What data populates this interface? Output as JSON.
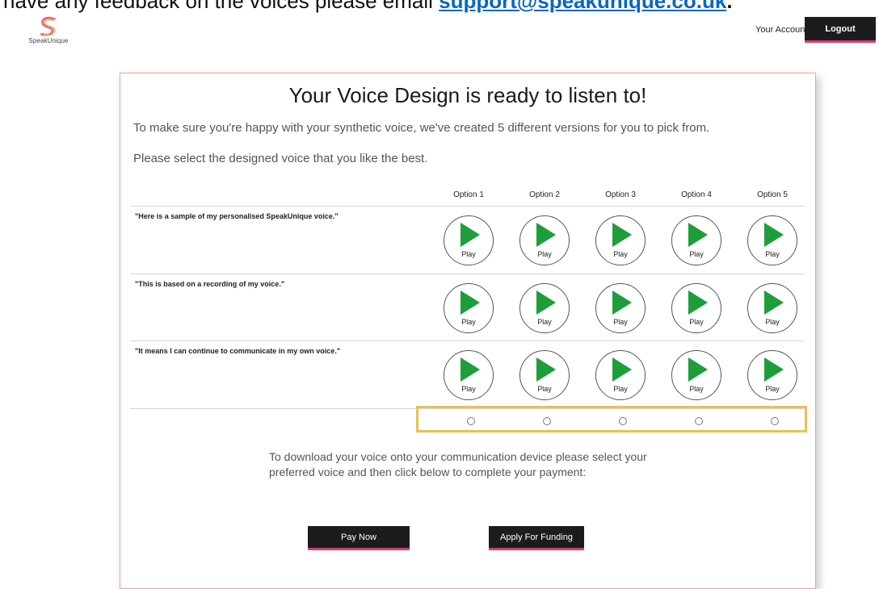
{
  "banner": {
    "lead_text": "have any feedback on the voices please email ",
    "email": "support@speakunique.co.uk",
    "trail": "."
  },
  "logo": {
    "text": "SpeakUnique",
    "icon": "speakunique-s-logo"
  },
  "nav": {
    "account": "Your Account",
    "logout": "Logout"
  },
  "page": {
    "title": "Your Voice Design is ready to listen to!",
    "intro": "To make sure you're happy with your synthetic voice, we've created 5 different versions for you to pick from.",
    "instruction": "Please select the designed voice that you like the best.",
    "options": [
      "Option 1",
      "Option 2",
      "Option 3",
      "Option 4",
      "Option 5"
    ],
    "samples": [
      "\"Here is a sample of my personalised SpeakUnique voice.\"",
      "\"This is based on a recording of my voice.\"",
      "\"It means I can continue to communicate in my own voice.\""
    ],
    "play_label": "Play",
    "download_text": "To download your voice onto your communication device please select your preferred voice and then click below to complete your payment:",
    "pay_button": "Pay Now",
    "funding_button": "Apply For Funding"
  },
  "colors": {
    "play_icon": "#1e9e3a",
    "selection_border": "#e8bf58",
    "button_accent": "#d63c72",
    "card_border": "#f0a48c"
  }
}
